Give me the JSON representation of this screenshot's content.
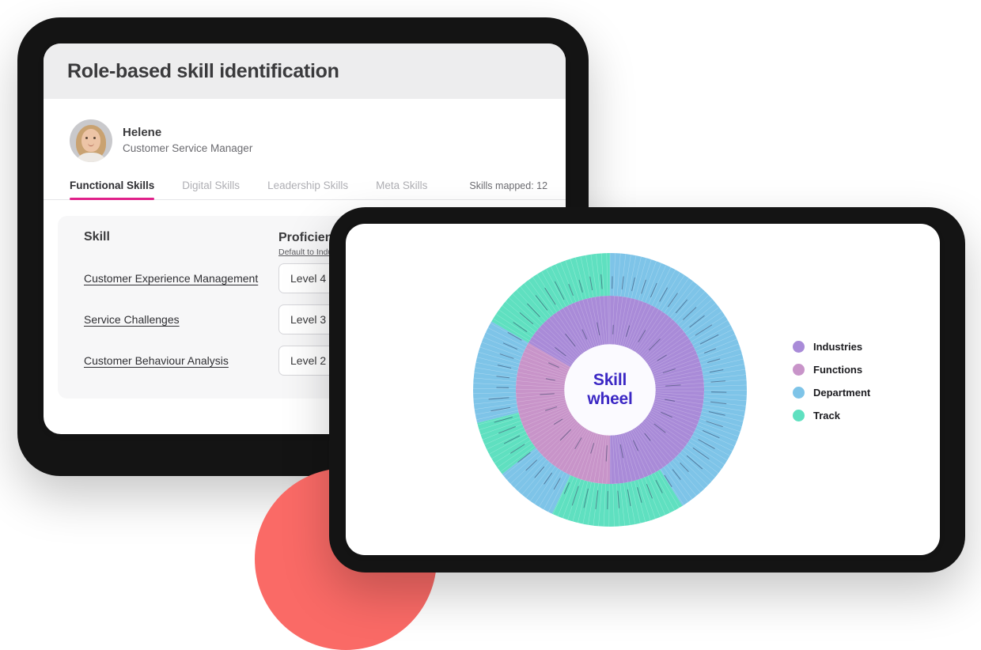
{
  "skills_panel": {
    "title": "Role-based skill identification",
    "profile": {
      "name": "Helene",
      "role": "Customer Service Manager",
      "avatar": "user-photo"
    },
    "tabs": [
      {
        "label": "Functional Skills",
        "active": true
      },
      {
        "label": "Digital Skills",
        "active": false
      },
      {
        "label": "Leadership Skills",
        "active": false
      },
      {
        "label": "Meta Skills",
        "active": false
      }
    ],
    "skills_mapped": "Skills mapped: 12",
    "table": {
      "columns": [
        "Skill",
        "Proficiency"
      ],
      "proficiency_sublabel": "Default to Industry",
      "rows": [
        {
          "skill": "Customer Experience Management",
          "level": "Level 4"
        },
        {
          "skill": "Service Challenges",
          "level": "Level 3"
        },
        {
          "skill": "Customer Behaviour Analysis",
          "level": "Level 2"
        }
      ]
    }
  },
  "wheel_panel": {
    "center_line1": "Skill",
    "center_line2": "wheel",
    "legend": [
      {
        "label": "Industries",
        "color": "#A98BD8"
      },
      {
        "label": "Functions",
        "color": "#C894C9"
      },
      {
        "label": "Department",
        "color": "#7EC4E8"
      },
      {
        "label": "Track",
        "color": "#5FE0C0"
      }
    ]
  },
  "chart_data": {
    "type": "pie",
    "title": "Skill wheel",
    "subtype": "sunburst",
    "legend_position": "right",
    "rings": [
      {
        "name": "inner",
        "slices": [
          {
            "label": "Industries",
            "color": "#A98BD8",
            "start_angle": 0,
            "end_angle": 180,
            "value": 50
          },
          {
            "label": "Functions",
            "color": "#C894C9",
            "start_angle": 180,
            "end_angle": 300,
            "value": 33
          },
          {
            "label": "Industries",
            "color": "#A98BD8",
            "start_angle": 300,
            "end_angle": 360,
            "value": 17
          }
        ]
      },
      {
        "name": "outer",
        "slices": [
          {
            "label": "Department",
            "color": "#7EC4E8",
            "start_angle": 0,
            "end_angle": 148,
            "value": 41
          },
          {
            "label": "Track",
            "color": "#5FE0C0",
            "start_angle": 148,
            "end_angle": 205,
            "value": 16
          },
          {
            "label": "Department",
            "color": "#7EC4E8",
            "start_angle": 205,
            "end_angle": 232,
            "value": 7
          },
          {
            "label": "Track",
            "color": "#5FE0C0",
            "start_angle": 232,
            "end_angle": 256,
            "value": 7
          },
          {
            "label": "Department",
            "color": "#7EC4E8",
            "start_angle": 256,
            "end_angle": 300,
            "value": 12
          },
          {
            "label": "Track",
            "color": "#5FE0C0",
            "start_angle": 300,
            "end_angle": 360,
            "value": 17
          }
        ]
      }
    ]
  },
  "decorations": {
    "red_circle_color": "#FA6A66",
    "device_frame_color": "#141414",
    "accent_color": "#E0218A",
    "center_text_color": "#3B27C4"
  }
}
